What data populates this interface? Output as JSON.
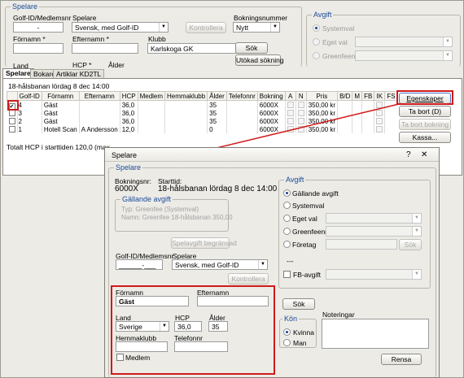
{
  "background_form": {
    "group_title": "Spelare",
    "golf_id_label": "Golf-ID/Medlemsnr",
    "golf_id_value": "-",
    "spelare_label": "Spelare",
    "spelare_value": "Svensk, med Golf-ID",
    "kontrollera": "Kontrollera",
    "bokningsnummer_label": "Bokningsnummer",
    "bokningsnummer_value": "Nytt",
    "fornamn_label": "Förnamn *",
    "efternamn_label": "Efternamn *",
    "klubb_label": "Klubb",
    "klubb_value": "Karlskoga GK",
    "sok": "Sök",
    "utokad_sokning": "Utökad sökning",
    "land_label": "Land",
    "hcp_label": "HCP *",
    "alder_label": "Ålder",
    "avgift_title": "Avgift",
    "avgift_systemval": "Systemval",
    "avgift_eget_val": "Eget val",
    "avgift_greenfeenr": "Greenfeenr"
  },
  "tabs": [
    "Spelare",
    "Bokare",
    "Artiklar KD2TL"
  ],
  "grid": {
    "title": "18-hålsbanan lördag 8 dec 14:00",
    "columns": [
      "",
      "Golf-ID",
      "Förnamn",
      "Efternamn",
      "HCP",
      "Medlem",
      "Hemmaklubb",
      "Ålder",
      "Telefonnr",
      "Bokning",
      "A",
      "N",
      "Pris",
      "B/D",
      "M",
      "FB",
      "IK",
      "FS"
    ],
    "rows": [
      {
        "num": "4",
        "fornamn": "Gäst",
        "efternamn": "",
        "hcp": "36,0",
        "alder": "35",
        "bokning": "6000X",
        "pris": "350,00 kr",
        "checked": true
      },
      {
        "num": "3",
        "fornamn": "Gäst",
        "efternamn": "",
        "hcp": "36,0",
        "alder": "35",
        "bokning": "6000X",
        "pris": "350,00 kr",
        "checked": false
      },
      {
        "num": "2",
        "fornamn": "Gäst",
        "efternamn": "",
        "hcp": "36,0",
        "alder": "35",
        "bokning": "6000X",
        "pris": "350,00 kr",
        "checked": false
      },
      {
        "num": "1",
        "fornamn": "Hotell Scan",
        "efternamn": "A Andersson",
        "hcp": "12,0",
        "alder": "0",
        "bokning": "6000X",
        "pris": "350,00 kr",
        "checked": false
      }
    ],
    "total": "Totalt HCP i starttiden 120,0 (max",
    "buttons": {
      "egenskaper": "Egenskaper",
      "ta_bort": "Ta bort (D)",
      "ta_bort_bokning": "Ta bort bokning",
      "kassa": "Kassa..."
    }
  },
  "dialog": {
    "title": "Spelare",
    "help": "?",
    "close": "✕",
    "group_title": "Spelare",
    "bokningsnr_label": "Bokningsnr:",
    "bokningsnr_value": "6000X",
    "starttid_label": "Starttid:",
    "starttid_value": "18-hålsbanan lördag 8 dec 14:00",
    "gallande_avgift_title": "Gällande avgift",
    "typ_line": "Typ: Greenfee     (Systemval)",
    "namn_line": "Namn: Greenfee 18-hålsbanan     350,00",
    "spelavgift_begransad": "Spelavgift begränsad",
    "golf_id_label": "Golf-ID/Medlemsnr",
    "golf_id_value": "______-___",
    "spelare_label": "Spelare",
    "spelare_value": "Svensk, med Golf-ID",
    "kontrollera": "Kontrollera",
    "fornamn_label": "Förnamn",
    "fornamn_value": "Gäst",
    "efternamn_label": "Efternamn",
    "efternamn_value": "",
    "land_label": "Land",
    "land_value": "Sverige",
    "hcp_label": "HCP",
    "hcp_value": "36,0",
    "alder_label": "Ålder",
    "alder_value": "35",
    "hemmaklubb_label": "Hemmaklubb",
    "telefonnr_label": "Telefonnr",
    "medlem_label": "Medlem",
    "sok": "Sök",
    "kon_title": "Kön",
    "kvinna": "Kvinna",
    "man": "Man",
    "noteringar_label": "Noteringar",
    "rensa": "Rensa",
    "avgift_title": "Avgift",
    "avgift_options": [
      "Gällande avgift",
      "Systemval",
      "Eget val",
      "Greenfeenr",
      "Företag"
    ],
    "avgift_sok": "Sök",
    "dash": "---",
    "fb_avgift": "FB-avgift"
  },
  "colors": {
    "highlight_red": "#d01a1a",
    "group_title_blue": "#1b4b98",
    "panel_bg": "#ecebe6"
  }
}
